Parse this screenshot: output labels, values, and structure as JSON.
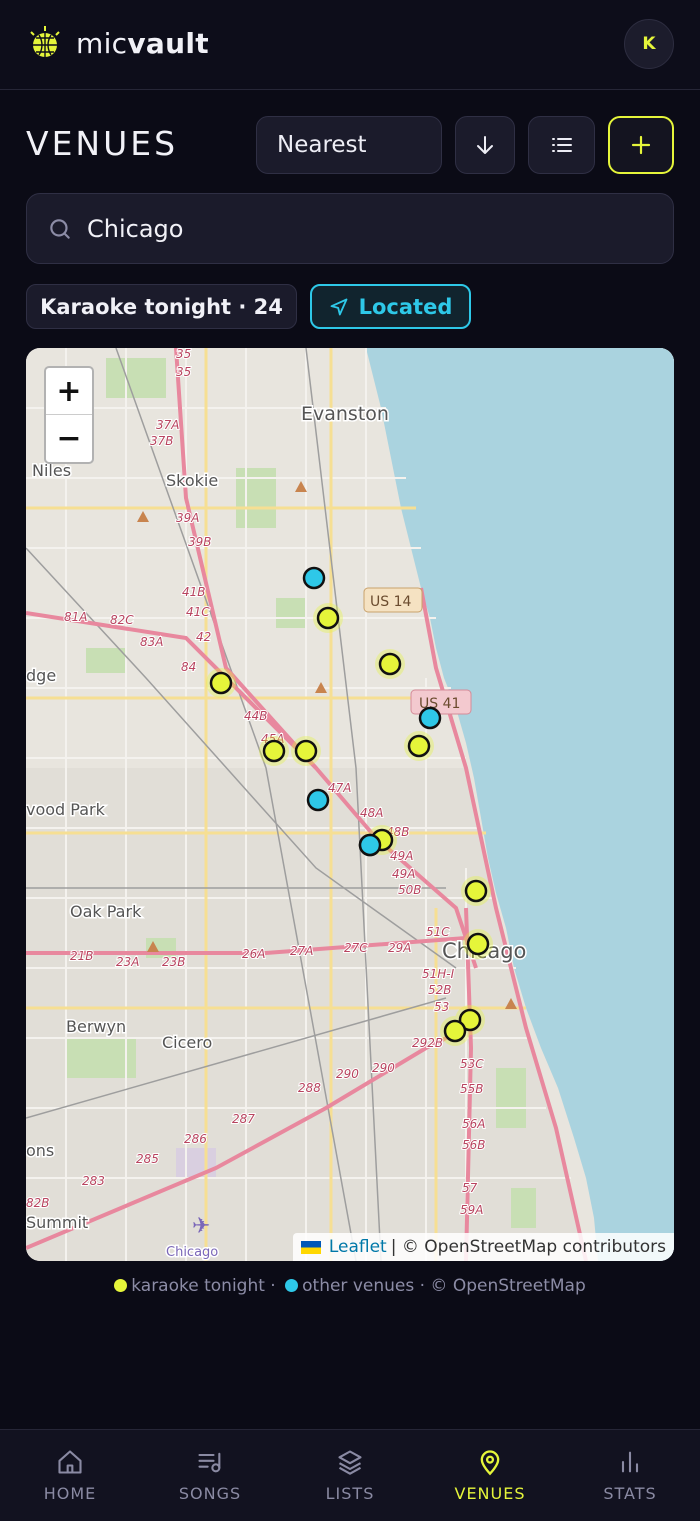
{
  "brand": {
    "name_light": "mic",
    "name_bold": "vault",
    "logo_icon": "disco-ball-mic-icon",
    "accent": "#e5f53a"
  },
  "user": {
    "avatar_initial": "K"
  },
  "page": {
    "title": "VENUES"
  },
  "toolbar": {
    "sort_value": "Nearest",
    "sort_direction_icon": "arrow-down-icon",
    "view_icon": "list-icon",
    "add_icon": "plus-icon"
  },
  "search": {
    "value": "Chicago",
    "icon": "search-icon"
  },
  "chips": {
    "tonight_label": "Karaoke tonight · 24",
    "located_label": "Located",
    "located_icon": "navigation-arrow-icon",
    "located_color": "#2ec8e8"
  },
  "map": {
    "zoom_in": "+",
    "zoom_out": "−",
    "attribution_leaflet": "Leaflet",
    "attribution_rest": "| © OpenStreetMap contributors",
    "labels": [
      "Evanston",
      "Skokie",
      "Niles",
      "Oak Park",
      "Berwyn",
      "Cicero",
      "Summit",
      "Chicago",
      "dge",
      "vood Park",
      "ons"
    ],
    "airport_label": "Chicago",
    "shields": [
      "US 14",
      "US 41"
    ],
    "road_numbers": [
      "35",
      "35",
      "37A",
      "37B",
      "39A",
      "39B",
      "41B",
      "41C",
      "42",
      "81A",
      "82C",
      "83A",
      "84",
      "44B",
      "45A",
      "47A",
      "48A",
      "48B",
      "49A",
      "49A",
      "50B",
      "51C",
      "51H-I",
      "52B",
      "53",
      "292B",
      "53C",
      "55B",
      "56A",
      "56B",
      "57",
      "59A",
      "21B",
      "23A",
      "23B",
      "26A",
      "27A",
      "27C",
      "29A",
      "288",
      "290",
      "290",
      "287",
      "286",
      "285",
      "283",
      "82B"
    ],
    "colors": {
      "tonight": "#e5f53a",
      "other": "#2ec8e8",
      "water": "#aad3df"
    }
  },
  "legend": {
    "tonight": "karaoke tonight ·",
    "other": "other venues · © OpenStreetMap"
  },
  "tabs": [
    {
      "label": "HOME",
      "icon": "home-icon",
      "active": false
    },
    {
      "label": "SONGS",
      "icon": "music-list-icon",
      "active": false
    },
    {
      "label": "LISTS",
      "icon": "layers-icon",
      "active": false
    },
    {
      "label": "VENUES",
      "icon": "map-pin-icon",
      "active": true
    },
    {
      "label": "STATS",
      "icon": "bar-chart-icon",
      "active": false
    }
  ]
}
